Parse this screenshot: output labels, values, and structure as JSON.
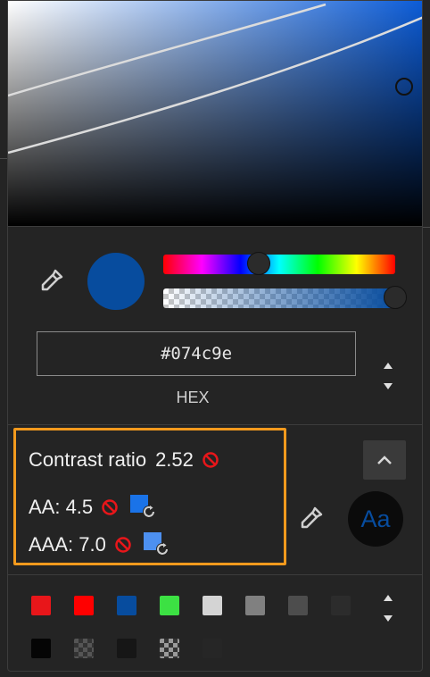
{
  "color_picker": {
    "current_color": "#074c9e",
    "hue_fraction": 0.41,
    "alpha_fraction": 1.0,
    "hex_input_value": "#074c9e",
    "format_label": "HEX"
  },
  "contrast": {
    "title": "Contrast ratio",
    "ratio": "2.52",
    "aa_label": "AA: 4.5",
    "aaa_label": "AAA: 7.0",
    "fail_color": "#e8161a",
    "highlight_border": "#f39a1d"
  },
  "preview": {
    "text": "Aa",
    "foreground": "#074c9e",
    "background": "#0b0b0b"
  },
  "icons": {
    "eyedropper": "eyedropper-icon",
    "no": "no-entry-icon",
    "fix": "auto-fix-icon",
    "collapse": "chevron-up-icon",
    "stepper": "up-down-stepper-icon"
  },
  "palette": {
    "row1": [
      "#e8161a",
      "#ff0000",
      "#074c9e",
      "#3ce143",
      "#d4d4d4",
      "#808080",
      "#4d4d4d",
      "#2c2c2c"
    ],
    "row2": [
      "#050505",
      "checker-gray",
      "#161616",
      "checker-light",
      "#262626"
    ]
  }
}
